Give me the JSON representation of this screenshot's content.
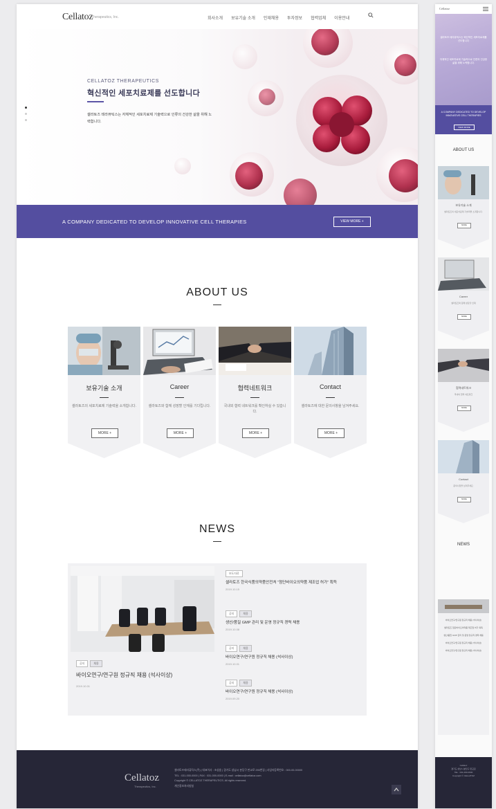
{
  "header": {
    "logo": "Cellatoz",
    "logo_sub": "Therapeutics, Inc.",
    "nav": [
      "회사소개",
      "보유기술 소개",
      "인재채용",
      "투자정보",
      "협력업체",
      "이용안내"
    ]
  },
  "hero": {
    "eyebrow": "CELLATOZ THERAPEUTICS",
    "title": "혁신적인 세포치료제를 선도합니다",
    "desc": "셀라토즈 테라퓨틱스는 자체적인 세포치료제 기술력으로 인류의 건강한 삶을 위해 노력합니다."
  },
  "banner": {
    "text": "A COMPANY DEDICATED TO DEVELOP INNOVATIVE CELL THERAPIES",
    "button": "VIEW MORE +"
  },
  "about": {
    "title": "ABOUT US",
    "cards": [
      {
        "title": "보유기술 소개",
        "desc": "셀라토즈의 세포치료제 기술력을 소개합니다.",
        "button": "MORE +"
      },
      {
        "title": "Career",
        "desc": "셀라토즈와 함께 성장할 인재를 기다립니다.",
        "button": "MORE +"
      },
      {
        "title": "협력네트워크",
        "desc": "국내외 협력 네트워크를 확인하실 수 있습니다.",
        "button": "MORE +"
      },
      {
        "title": "Contact",
        "desc": "셀라토즈에 대한 문의사항을 남겨주세요.",
        "button": "MORE +"
      }
    ]
  },
  "news": {
    "title": "NEWS",
    "featured": {
      "tags": [
        "공지",
        "채용"
      ],
      "title": "바이오연구/연구원 정규직 채용 (석사이상)",
      "date": "2019.10.01"
    },
    "items": [
      {
        "tags": [
          "보도자료"
        ],
        "title": "셀라토즈 한국식품의약품안전처 \"첨단바이오의약품 제조업 허가\" 획득",
        "date": "2019.10.15"
      },
      {
        "tags": [
          "공지",
          "채용"
        ],
        "title": "생산/품질 GMP 관리 및 운영 정규직 경력 채용",
        "date": "2019.10.08"
      },
      {
        "tags": [
          "공지",
          "채용"
        ],
        "title": "바이오연구/연구원 정규직 채용 (석사이상)",
        "date": "2019.10.01"
      },
      {
        "tags": [
          "공지",
          "채용"
        ],
        "title": "바이오연구/연구원 정규직 채용 (석사이상)",
        "date": "2019.09.20"
      }
    ]
  },
  "footer": {
    "logo": "Cellatoz",
    "logo_sub": "Therapeutics, Inc.",
    "lines": [
      "셀라토즈테라퓨틱스(주) | 대표이사 : 조성훈 | 경기도 성남시 분당구 판교로 255번길 | 사업자등록번호 : 000-00-00000",
      "TEL : 031-000-0000 | FAX : 031-000-0000 | E-mail : cellatoz@cellatoz.com",
      "Copyright © CELLATOZ THERAPEUTICS. All rights reserved.",
      "개인정보처리방침"
    ]
  },
  "mobile": {
    "hero_text": "셀라토즈 테라퓨틱스는 혁신적인 세포치료제를 선도합니다",
    "hero_text2": "자체적인 세포치료제 기술력으로 인류의 건강한 삶을 위해 노력합니다.",
    "band_text": "A COMPANY DEDICATED TO DEVELOP INNOVATIVE CELL THERAPIES",
    "band_button": "VIEW MORE",
    "about_title": "ABOUT US",
    "news_title": "NEWS",
    "cards": [
      {
        "title": "보유기술 소개",
        "desc": "셀라토즈의 세포치료제 기술력을 소개합니다.",
        "button": "MORE"
      },
      {
        "title": "Career",
        "desc": "셀라토즈와 함께 성장할 인재",
        "button": "MORE"
      },
      {
        "title": "협력네트워크",
        "desc": "국내외 협력 네트워크",
        "button": "MORE"
      },
      {
        "title": "Contact",
        "desc": "문의사항을 남겨주세요.",
        "button": "MORE"
      }
    ],
    "news_items": [
      "바이오연구/연구원 정규직 채용 (석사이상)",
      "셀라토즈 첨단바이오의약품 제조업 허가 획득",
      "생산/품질 GMP 관리 및 운영 정규직 경력 채용",
      "바이오연구/연구원 정규직 채용 (석사이상)",
      "바이오연구/연구원 정규직 채용 (석사이상)"
    ],
    "footer_lines": [
      "Cellatoz",
      "경기도 성남시 분당구 판교로",
      "TEL : 031-000-0000",
      "Copyright © CELLATOZ"
    ]
  },
  "colors": {
    "accent": "#544ea0",
    "footer": "#262637",
    "card_bg": "#f1f1f3"
  }
}
